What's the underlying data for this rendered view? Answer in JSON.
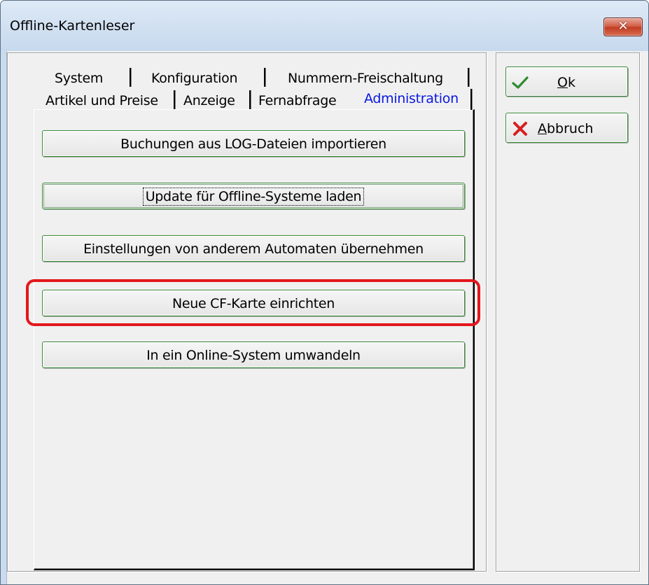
{
  "window": {
    "title": "Offline-Kartenleser",
    "close_glyph": "✕"
  },
  "tabs": {
    "row_top": [
      {
        "label": "System"
      },
      {
        "label": "Konfiguration"
      },
      {
        "label": "Nummern-Freischaltung"
      }
    ],
    "row_bottom": [
      {
        "label": "Artikel und Preise"
      },
      {
        "label": "Anzeige"
      },
      {
        "label": "Fernabfrage"
      },
      {
        "label": "Administration",
        "active": true
      }
    ]
  },
  "admin_buttons": [
    {
      "label": "Buchungen aus LOG-Dateien importieren"
    },
    {
      "label": "Update für Offline-Systeme laden",
      "focused": true
    },
    {
      "label": "Einstellungen von anderem Automaten übernehmen"
    },
    {
      "label": "Neue CF-Karte einrichten",
      "highlighted": true
    },
    {
      "label": "In ein Online-System umwandeln"
    }
  ],
  "side_buttons": {
    "ok": {
      "accel": "O",
      "rest": "k",
      "icon": "checkmark-icon",
      "icon_color": "#2e8b2e"
    },
    "cancel": {
      "accel": "A",
      "rest": "bbruch",
      "icon": "red-x-icon",
      "icon_color": "#d81e1e"
    }
  },
  "colors": {
    "active_tab": "#0a18e0",
    "highlight": "#e3171d",
    "button_border": "#3c8a3c"
  }
}
